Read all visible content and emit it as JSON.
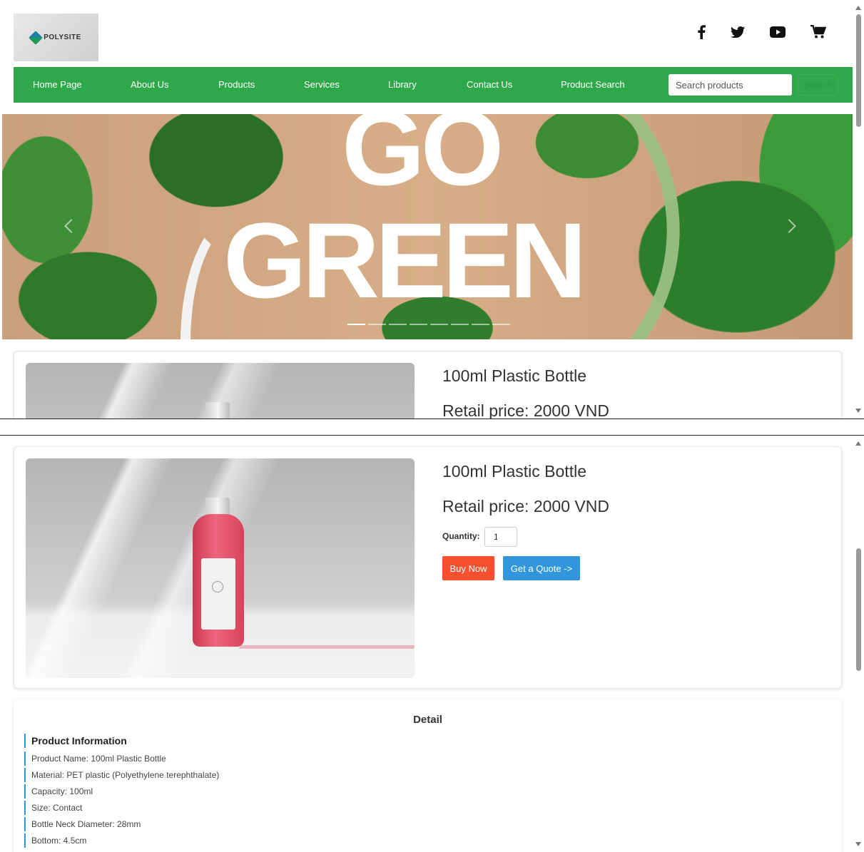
{
  "header": {
    "logo_text": "POLYSITE",
    "icons": [
      "facebook-icon",
      "twitter-icon",
      "youtube-icon",
      "cart-icon"
    ]
  },
  "nav": {
    "items": [
      "Home Page",
      "About Us",
      "Products",
      "Services",
      "Library",
      "Contact Us",
      "Product Search"
    ],
    "search_placeholder": "Search products",
    "search_button": "Search",
    "color": "#2ea84a"
  },
  "banner": {
    "line1": "GO",
    "line2": "GREEN",
    "slide_count": 8,
    "active_slide": 1
  },
  "product": {
    "title": "100ml Plastic Bottle",
    "price": "Retail price: 2000 VND",
    "quantity_label": "Quantity:",
    "quantity_value": "1",
    "buy_label": "Buy Now",
    "quote_label": "Get a Quote ->",
    "buy_color": "#f6502e",
    "quote_color": "#3196dc"
  },
  "detail": {
    "title": "Detail",
    "section_heading": "Product Information",
    "specs": [
      "Product Name: 100ml Plastic Bottle",
      "Material: PET plastic (Polyethylene terephthalate)",
      "Capacity: 100ml",
      "Size: Contact",
      "Bottle Neck Diameter: 28mm",
      "Bottom: 4.5cm"
    ]
  }
}
